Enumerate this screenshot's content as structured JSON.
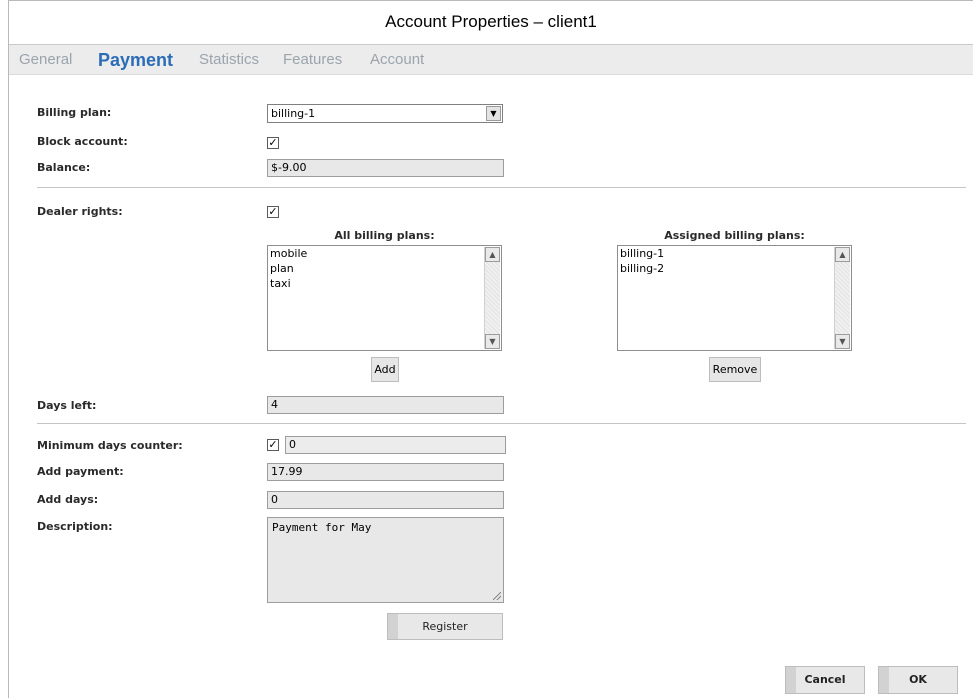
{
  "window": {
    "title": "Account Properties – client1"
  },
  "tabs": [
    {
      "label": "General"
    },
    {
      "label": "Payment"
    },
    {
      "label": "Statistics"
    },
    {
      "label": "Features"
    },
    {
      "label": "Account"
    }
  ],
  "active_tab": "Payment",
  "form": {
    "billing_plan_label": "Billing plan:",
    "billing_plan_value": "billing-1",
    "block_account_label": "Block account:",
    "block_account_checked": true,
    "balance_label": "Balance:",
    "balance_value": "$-9.00",
    "dealer_rights_label": "Dealer rights:",
    "dealer_rights_checked": true,
    "all_plans_title": "All billing plans:",
    "all_plans": [
      "mobile",
      "plan",
      "taxi"
    ],
    "assigned_plans_title": "Assigned billing plans:",
    "assigned_plans": [
      "billing-1",
      "billing-2"
    ],
    "add_label": "Add",
    "remove_label": "Remove",
    "days_left_label": "Days left:",
    "days_left_value": "4",
    "min_days_label": "Minimum days counter:",
    "min_days_checked": true,
    "min_days_value": "0",
    "add_payment_label": "Add payment:",
    "add_payment_value": "17.99",
    "add_days_label": "Add days:",
    "add_days_value": "0",
    "description_label": "Description:",
    "description_value": "Payment for May",
    "register_label": "Register"
  },
  "footer": {
    "cancel_label": "Cancel",
    "ok_label": "OK"
  },
  "icons": {
    "checkmark": "✓",
    "dropdown": "▼",
    "scroll_up": "▲",
    "scroll_down": "▼"
  },
  "colors": {
    "active_tab": "#2b6cb8",
    "inactive_tab": "#9aa4ad",
    "field_bg": "#e8e8e8"
  }
}
